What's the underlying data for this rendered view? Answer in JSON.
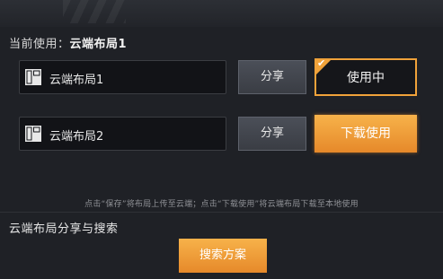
{
  "current": {
    "prefix": "当前使用：",
    "value": "云端布局1"
  },
  "slots": [
    {
      "name": "云端布局1",
      "share_label": "分享",
      "action_label": "使用中",
      "action_state": "in-use"
    },
    {
      "name": "云端布局2",
      "share_label": "分享",
      "action_label": "下载使用",
      "action_state": "download"
    }
  ],
  "hint": "点击“保存”将布局上传至云端；点击“下载使用”将云端布局下载至本地使用",
  "section_title": "云端布局分享与搜索",
  "search_button_label": "搜索方案",
  "icons": {
    "slot_icon": "layout-grid-icon",
    "in_use_badge": "check-icon"
  },
  "colors": {
    "accent_orange": "#f0a23a",
    "background": "#1f2126"
  }
}
